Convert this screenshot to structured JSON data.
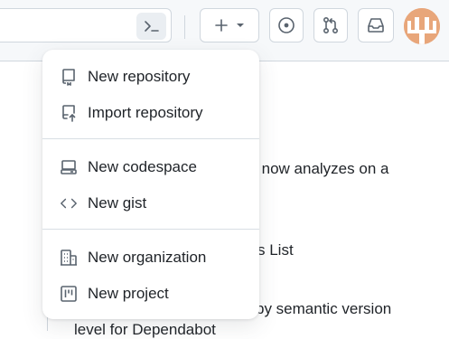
{
  "header": {
    "command_palette_icon": "terminal-icon",
    "create_icon": "plus-icon",
    "create_caret_icon": "triangle-down-icon",
    "issues_icon": "issue-opened-icon",
    "pull_requests_icon": "git-pull-request-icon",
    "inbox_icon": "inbox-icon",
    "avatar_color": "#e8a67a"
  },
  "create_menu": {
    "groups": [
      [
        {
          "label": "New repository",
          "icon": "repo-icon"
        },
        {
          "label": "Import repository",
          "icon": "repo-push-icon"
        }
      ],
      [
        {
          "label": "New codespace",
          "icon": "codespaces-icon"
        },
        {
          "label": "New gist",
          "icon": "code-icon"
        }
      ],
      [
        {
          "label": "New organization",
          "icon": "organization-icon"
        },
        {
          "label": "New project",
          "icon": "project-icon"
        }
      ]
    ]
  },
  "background": {
    "line1": "up now analyzes on a",
    "line2": "s List",
    "line3": "by semantic version",
    "line4": "level for Dependabot"
  },
  "colors": {
    "header_bg": "#f6f8fa",
    "border": "#d0d7de",
    "text": "#1f2328",
    "icon": "#59636e"
  }
}
